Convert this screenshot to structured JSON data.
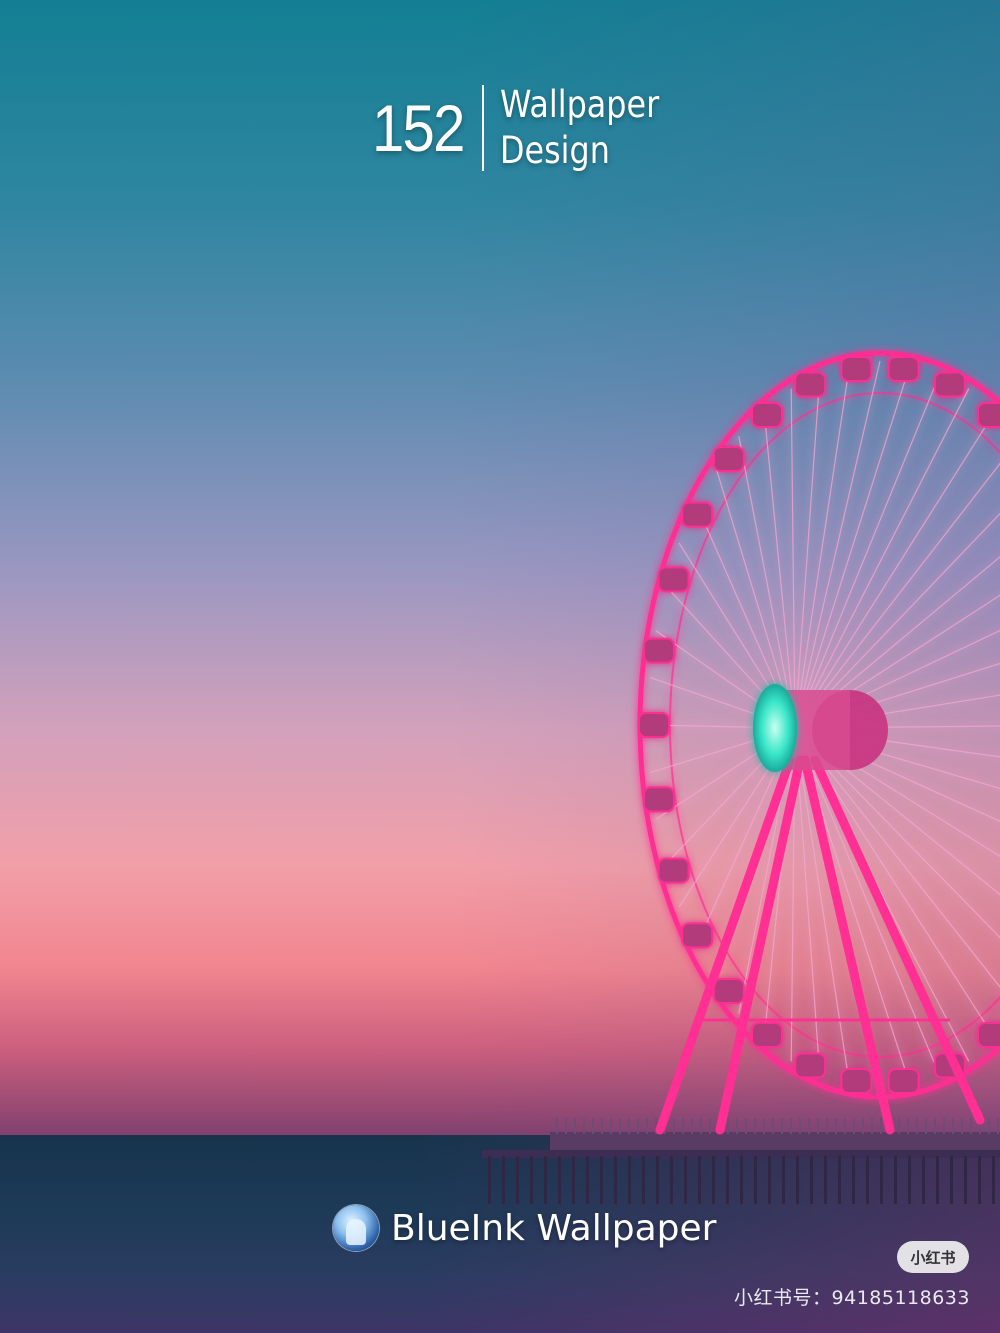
{
  "title": {
    "number": "152",
    "line1": "Wallpaper",
    "line2": "Design"
  },
  "credit": {
    "avatar_icon": "avatar-icon",
    "name": "BlueInk Wallpaper"
  },
  "watermark": {
    "logo_text": "小红书",
    "id_text": "小红书号：94185118633"
  },
  "colors": {
    "wheel": "#ff2f93",
    "hub": "#39e6c8",
    "sky_top": "#137f93",
    "sky_horizon": "#f1858f",
    "sea": "#1d3a57"
  }
}
